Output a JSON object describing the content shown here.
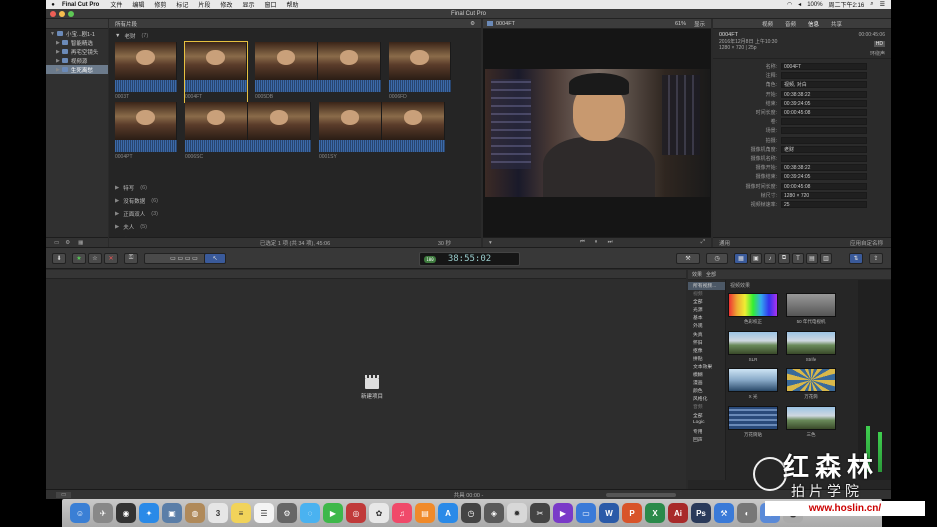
{
  "menubar": {
    "app_name": "Final Cut Pro",
    "items": [
      "文件",
      "编辑",
      "修剪",
      "标记",
      "片段",
      "修改",
      "显示",
      "窗口",
      "帮助"
    ],
    "battery": "100%",
    "clock": "周二下午2:16"
  },
  "window": {
    "title": "Final Cut Pro"
  },
  "libraries": {
    "header": "",
    "items": [
      {
        "label": "小宝...剧1-1",
        "selected": false
      },
      {
        "label": "智能精选",
        "selected": false
      },
      {
        "label": "再宅空镜头",
        "selected": false
      },
      {
        "label": "视频源",
        "selected": false
      },
      {
        "label": "生死离愁",
        "selected": true
      }
    ]
  },
  "browser": {
    "header_label": "所有片段",
    "group_open": {
      "label": "老财",
      "count": "(7)"
    },
    "clips": [
      {
        "name": "0003T",
        "selected": false,
        "frames": 1
      },
      {
        "name": "0004FT",
        "selected": true,
        "frames": 1
      },
      {
        "name": "0005DB",
        "selected": false,
        "frames": 2
      },
      {
        "name": "0006FD",
        "selected": false,
        "frames": 1
      },
      {
        "name": "0004PT",
        "selected": false,
        "frames": 1
      },
      {
        "name": "0006SC",
        "selected": false,
        "frames": 2
      },
      {
        "name": "0001SY",
        "selected": false,
        "frames": 2
      }
    ],
    "groups_closed": [
      {
        "label": "特写",
        "count": "(6)"
      },
      {
        "label": "没有数据",
        "count": "(6)"
      },
      {
        "label": "正面双人",
        "count": "(3)"
      },
      {
        "label": "夫人",
        "count": "(5)"
      },
      {
        "label": "全景",
        "count": "(4)"
      }
    ],
    "footer_status": "已选定 1 项 (共 34 项), 45:06",
    "footer_zoom": "30 秒"
  },
  "viewer": {
    "clip_name": "0004FT",
    "zoom": "61%",
    "view_menu": "显示"
  },
  "inspector": {
    "tabs": [
      "视频",
      "音频",
      "信息",
      "共享"
    ],
    "clip_name": "0004FT",
    "date": "2016年12月8日 上午10:30",
    "format": "1280 × 720  |  25p",
    "duration": "00:00:45:06",
    "audio_format": "环绕声",
    "badge": "HD",
    "rows": [
      {
        "label": "名称:",
        "value": "0004FT"
      },
      {
        "label": "注释:",
        "value": ""
      },
      {
        "label": "角色:",
        "value": "视频, 对白"
      },
      {
        "label": "开始:",
        "value": "00:38:38:22"
      },
      {
        "label": "结束:",
        "value": "00:39:24:05"
      },
      {
        "label": "时间长度:",
        "value": "00:00:45:08"
      },
      {
        "label": "卷:",
        "value": ""
      },
      {
        "label": "场景:",
        "value": ""
      },
      {
        "label": "拍摄:",
        "value": ""
      },
      {
        "label": "摄像机角度:",
        "value": "老财"
      },
      {
        "label": "摄像机名称:",
        "value": ""
      },
      {
        "label": "摄像开始:",
        "value": "00:38:38:22"
      },
      {
        "label": "摄像结束:",
        "value": "00:39:24:05"
      },
      {
        "label": "摄像时间长度:",
        "value": "00:00:45:08"
      },
      {
        "label": "帧尺寸:",
        "value": "1280 × 720"
      },
      {
        "label": "视频帧速率:",
        "value": "25"
      }
    ],
    "footer_left": "通用",
    "footer_right": "应用自定名称"
  },
  "toolbar": {
    "timecode": "38:55:02",
    "timecode_badge": "100"
  },
  "timeline": {
    "new_project_label": "新建项目"
  },
  "effects": {
    "tabs": [
      "效果",
      "全部"
    ],
    "categories": [
      {
        "label": "所有视频...",
        "sel": true,
        "sec": false
      },
      {
        "label": "视频",
        "sel": false,
        "sec": true
      },
      {
        "label": "全部",
        "sel": false,
        "sec": false
      },
      {
        "label": "光源",
        "sel": false,
        "sec": false
      },
      {
        "label": "基本",
        "sel": false,
        "sec": false
      },
      {
        "label": "外观",
        "sel": false,
        "sec": false
      },
      {
        "label": "失真",
        "sel": false,
        "sec": false
      },
      {
        "label": "怀旧",
        "sel": false,
        "sec": false
      },
      {
        "label": "抠像",
        "sel": false,
        "sec": false
      },
      {
        "label": "拼贴",
        "sel": false,
        "sec": false
      },
      {
        "label": "文本效果",
        "sel": false,
        "sec": false
      },
      {
        "label": "模糊",
        "sel": false,
        "sec": false
      },
      {
        "label": "漫画",
        "sel": false,
        "sec": false
      },
      {
        "label": "颜色",
        "sel": false,
        "sec": false
      },
      {
        "label": "风格化",
        "sel": false,
        "sec": false
      },
      {
        "label": "音频",
        "sel": false,
        "sec": true
      },
      {
        "label": "全部",
        "sel": false,
        "sec": false
      },
      {
        "label": "Logic",
        "sel": false,
        "sec": false
      },
      {
        "label": "专用",
        "sel": false,
        "sec": false
      },
      {
        "label": "回声",
        "sel": false,
        "sec": false
      }
    ],
    "section_title": "视频效果",
    "items": [
      {
        "label": "色彩校正",
        "style": "rainbow"
      },
      {
        "label": "50 年代电视机",
        "style": "grey"
      },
      {
        "label": "SLR",
        "style": "landscape"
      },
      {
        "label": "Strife",
        "style": "landscape"
      },
      {
        "label": "X 光",
        "style": "xray"
      },
      {
        "label": "万花筒",
        "style": "kaleido"
      },
      {
        "label": "万花筒贴",
        "style": "tiles"
      },
      {
        "label": "三色",
        "style": "landscape"
      }
    ]
  },
  "statusbar": {
    "text": "共具 00:00 -"
  },
  "watermark": {
    "title": "红森林",
    "subtitle": "拍片学院",
    "url": "www.hoslin.cn/"
  },
  "dock": [
    {
      "name": "finder-icon",
      "color": "#3a7fd5",
      "glyph": "☺"
    },
    {
      "name": "launchpad-icon",
      "color": "#888",
      "glyph": "✈"
    },
    {
      "name": "dashboard-icon",
      "color": "#333",
      "glyph": "◉"
    },
    {
      "name": "safari-icon",
      "color": "#2a8ae8",
      "glyph": "✦"
    },
    {
      "name": "preview-icon",
      "color": "#5a7ea8",
      "glyph": "▣"
    },
    {
      "name": "contacts-icon",
      "color": "#b08a5a",
      "glyph": "◍"
    },
    {
      "name": "calendar-icon",
      "color": "#e6e6e6",
      "glyph": "3"
    },
    {
      "name": "notes-icon",
      "color": "#f1d35a",
      "glyph": "≡"
    },
    {
      "name": "reminders-icon",
      "color": "#f4f4f4",
      "glyph": "☰"
    },
    {
      "name": "system-prefs-icon",
      "color": "#666",
      "glyph": "⚙"
    },
    {
      "name": "messages-icon",
      "color": "#4ab2f0",
      "glyph": "◌"
    },
    {
      "name": "facetime-icon",
      "color": "#3eb84a",
      "glyph": "▶"
    },
    {
      "name": "photo-booth-icon",
      "color": "#c03a3a",
      "glyph": "◎"
    },
    {
      "name": "photos-icon",
      "color": "#e8e8e8",
      "glyph": "✿"
    },
    {
      "name": "music-icon",
      "color": "#f04a6a",
      "glyph": "♫"
    },
    {
      "name": "ibooks-icon",
      "color": "#f08a2a",
      "glyph": "▤"
    },
    {
      "name": "app-store-icon",
      "color": "#2a8ae8",
      "glyph": "A"
    },
    {
      "name": "time-machine-icon",
      "color": "#444",
      "glyph": "◷"
    },
    {
      "name": "compressor-icon",
      "color": "#5a5a5a",
      "glyph": "◈"
    },
    {
      "name": "motion-icon",
      "color": "#d8d8d8",
      "glyph": "✹"
    },
    {
      "name": "final-cut-icon",
      "color": "#444",
      "glyph": "✂"
    },
    {
      "name": "video-icon",
      "color": "#7a3ac8",
      "glyph": "▶"
    },
    {
      "name": "folder-icon",
      "color": "#3a7ad8",
      "glyph": "▭"
    },
    {
      "name": "word-icon",
      "color": "#2a5aa8",
      "glyph": "W"
    },
    {
      "name": "powerpoint-icon",
      "color": "#d8542a",
      "glyph": "P"
    },
    {
      "name": "excel-icon",
      "color": "#2a8a4a",
      "glyph": "X"
    },
    {
      "name": "adobe-icon",
      "color": "#a82a2a",
      "glyph": "Ai"
    },
    {
      "name": "photoshop-icon",
      "color": "#2a3a5a",
      "glyph": "Ps"
    },
    {
      "name": "xcode-icon",
      "color": "#3a7ad8",
      "glyph": "⚒"
    },
    {
      "name": "utility-icon",
      "color": "#777",
      "glyph": "◐"
    },
    {
      "name": "downloads-icon",
      "color": "#5a8ad8",
      "glyph": "↓"
    },
    {
      "name": "trash-icon",
      "color": "#aaa",
      "glyph": "🗑"
    }
  ]
}
